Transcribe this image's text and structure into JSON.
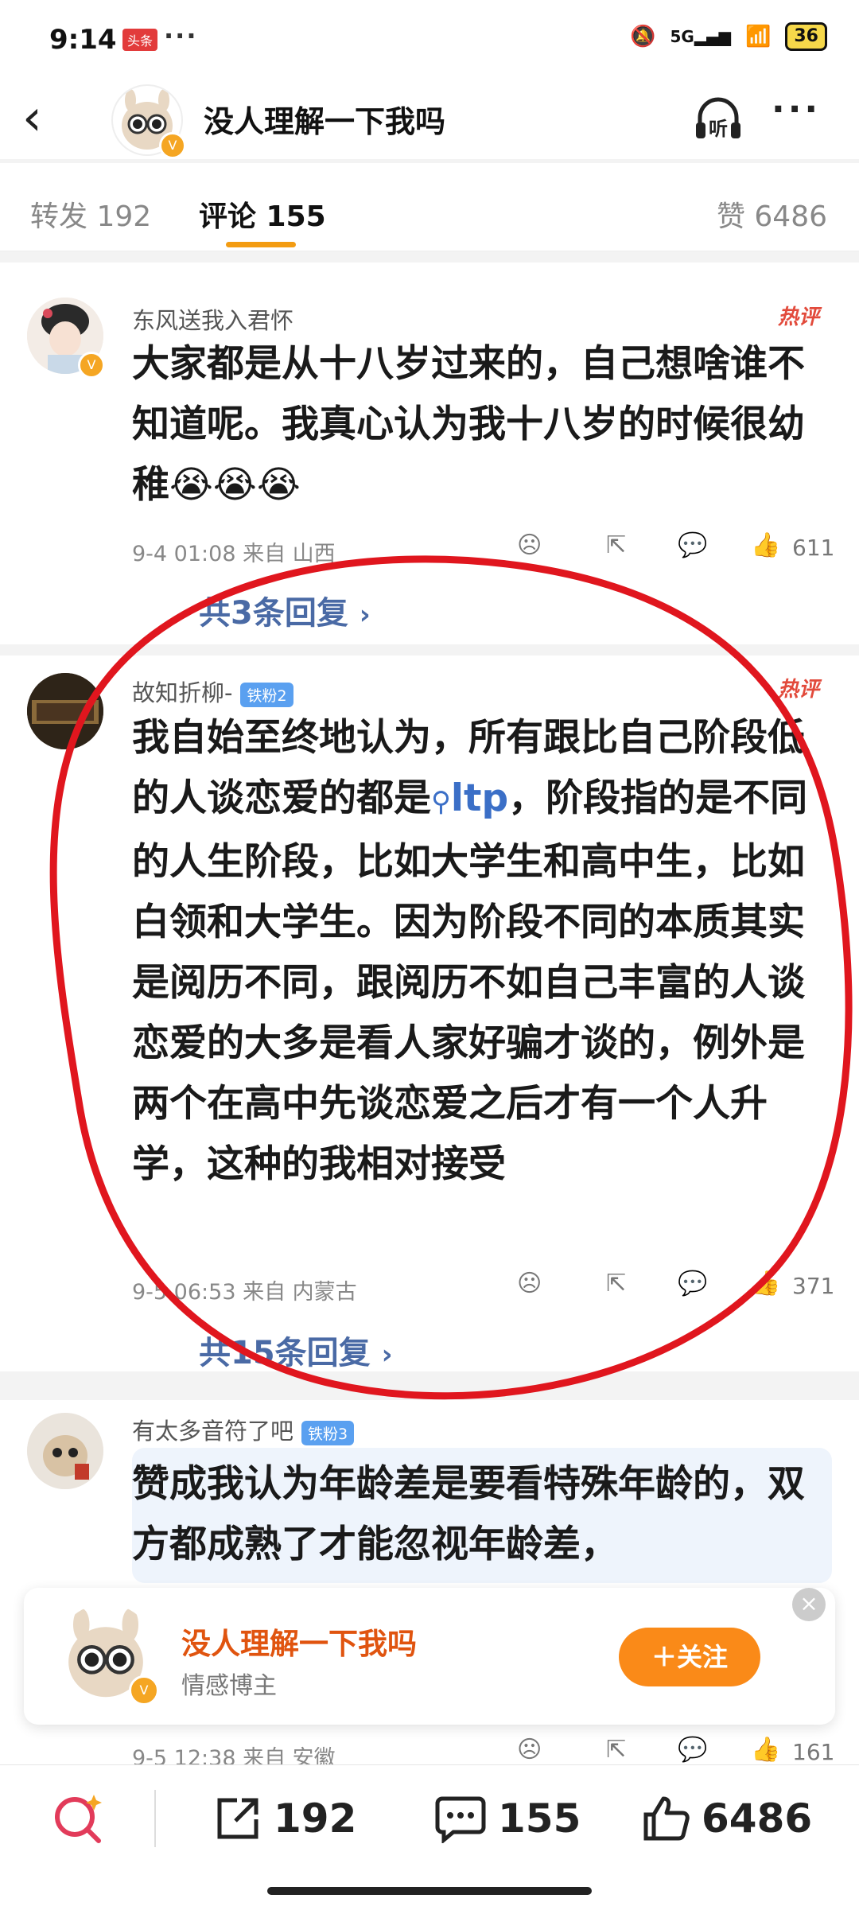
{
  "status_bar": {
    "time": "9:14",
    "app_badge": "头条",
    "more": "···",
    "signal": "5G",
    "battery": "36"
  },
  "header": {
    "title": "没人理解一下我吗",
    "listen_label": "听",
    "more": "···"
  },
  "tabs": {
    "repost": "转发 192",
    "comments": "评论 155",
    "likes": "赞 6486"
  },
  "comments": [
    {
      "name": "东风送我入君怀",
      "badge": "",
      "hot": "热评",
      "text": "大家都是从十八岁过来的，自己想啥谁不知道呢。我真心认为我十八岁的时候很幼稚😭😭😭",
      "meta": "9-4 01:08 来自 山西",
      "likes": "611",
      "replies": "共3条回复",
      "replies_arrow": "›"
    },
    {
      "name": "故知折柳-",
      "badge": "铁粉2",
      "hot": "热评",
      "text_before": "我自始至终地认为，所有跟比自己阶段低的人谈恋爱的都是",
      "search_term": "ltp",
      "text_after": "，阶段指的是不同的人生阶段，比如大学生和高中生，比如白领和大学生。因为阶段不同的本质其实是阅历不同，跟阅历不如自己丰富的人谈恋爱的大多是看人家好骗才谈的，例外是两个在高中先谈恋爱之后才有一个人升学，这种的我相对接受",
      "meta": "9-5 06:53 来自 内蒙古",
      "likes": "371",
      "replies": "共15条回复",
      "replies_arrow": "›"
    },
    {
      "name": "有太多音符了吧",
      "badge": "铁粉3",
      "text": "赞成我认为年龄差是要看特殊年龄的，双方都成熟了才能忽视年龄差，",
      "meta": "9-5 12:38 来自 安徽",
      "likes": "161"
    }
  ],
  "follow_card": {
    "name": "没人理解一下我吗",
    "subtitle": "情感博主",
    "button": "＋关注",
    "close": "×"
  },
  "bottom_bar": {
    "reposts": "192",
    "comments": "155",
    "likes": "6486"
  },
  "colors": {
    "accent": "#f39c12",
    "hot": "#e24a3b",
    "follow_button": "#fa8a18",
    "annotation_circle": "#e0161e"
  }
}
